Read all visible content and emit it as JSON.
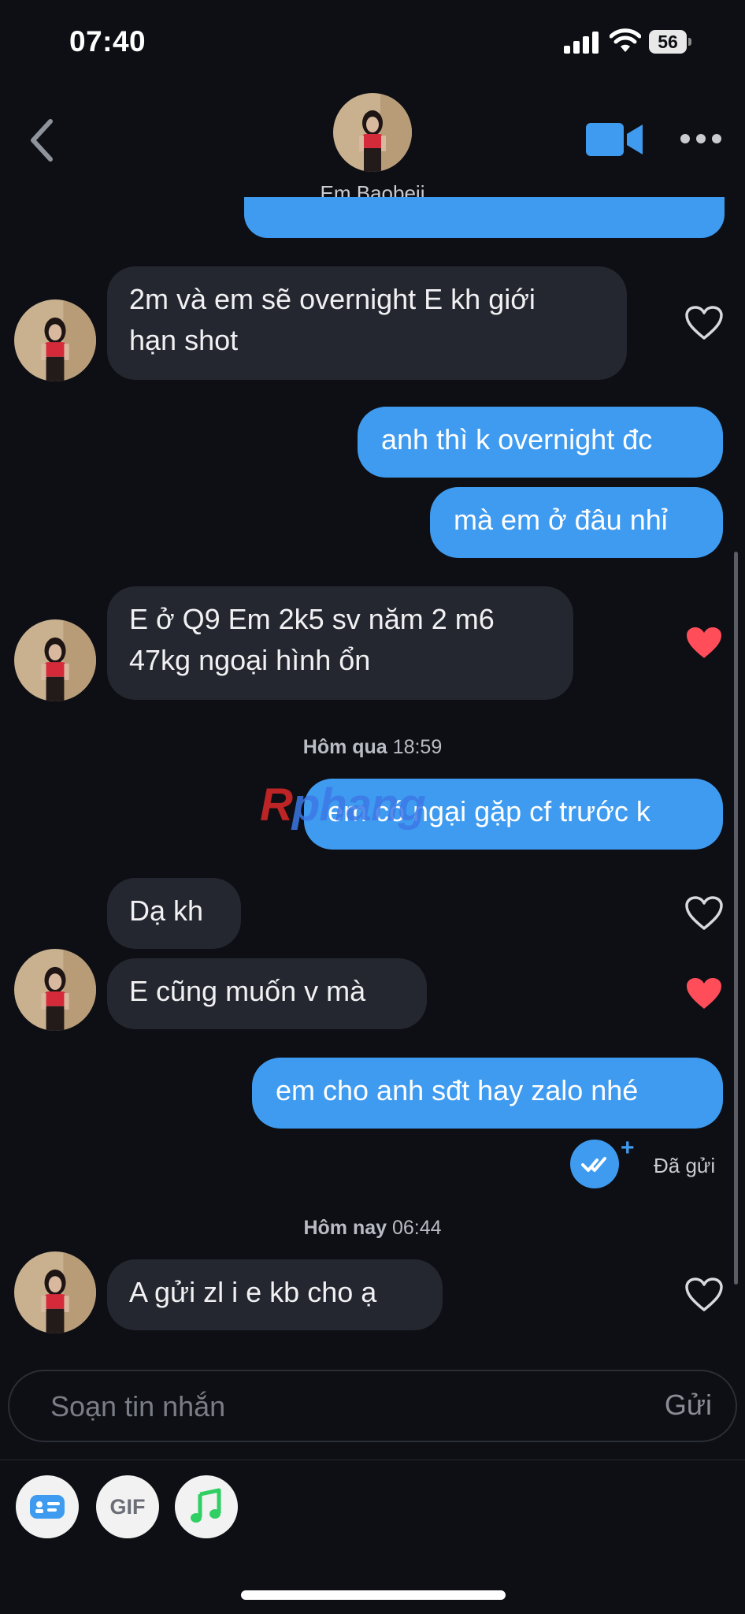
{
  "status_bar": {
    "time": "07:40",
    "battery": "56"
  },
  "header": {
    "contact_name": "Em Baobeii"
  },
  "messages": [
    {
      "text_line1": "2m và em sẽ overnight E kh giới",
      "text_line2": "hạn shot"
    },
    {
      "text": "anh thì k overnight đc"
    },
    {
      "text": "mà em ở đâu nhỉ"
    },
    {
      "text_line1": "E ở Q9 Em 2k5 sv năm 2 m6",
      "text_line2": "47kg ngoại hình ổn"
    },
    {
      "text": "em có ngại gặp cf trước k"
    },
    {
      "text": "Dạ kh"
    },
    {
      "text": "E cũng muốn v mà"
    },
    {
      "text": "em cho anh sđt hay zalo nhé"
    },
    {
      "text": "A gửi zl i e kb cho ạ"
    }
  ],
  "timestamps": [
    {
      "day": "Hôm qua",
      "time": "18:59"
    },
    {
      "day": "Hôm nay",
      "time": "06:44"
    }
  ],
  "delivery_status": "Đã gửi",
  "composer": {
    "placeholder": "Soạn tin nhắn",
    "send_label": "Gửi"
  },
  "toolbar": {
    "gif_label": "GIF"
  },
  "watermark": {
    "part1": "R",
    "part2": "phang"
  },
  "colors": {
    "background": "#0d0f14",
    "incoming_bubble": "#252730",
    "outgoing_bubble": "#3f9bf0",
    "heart_liked": "#ff4d5a"
  }
}
